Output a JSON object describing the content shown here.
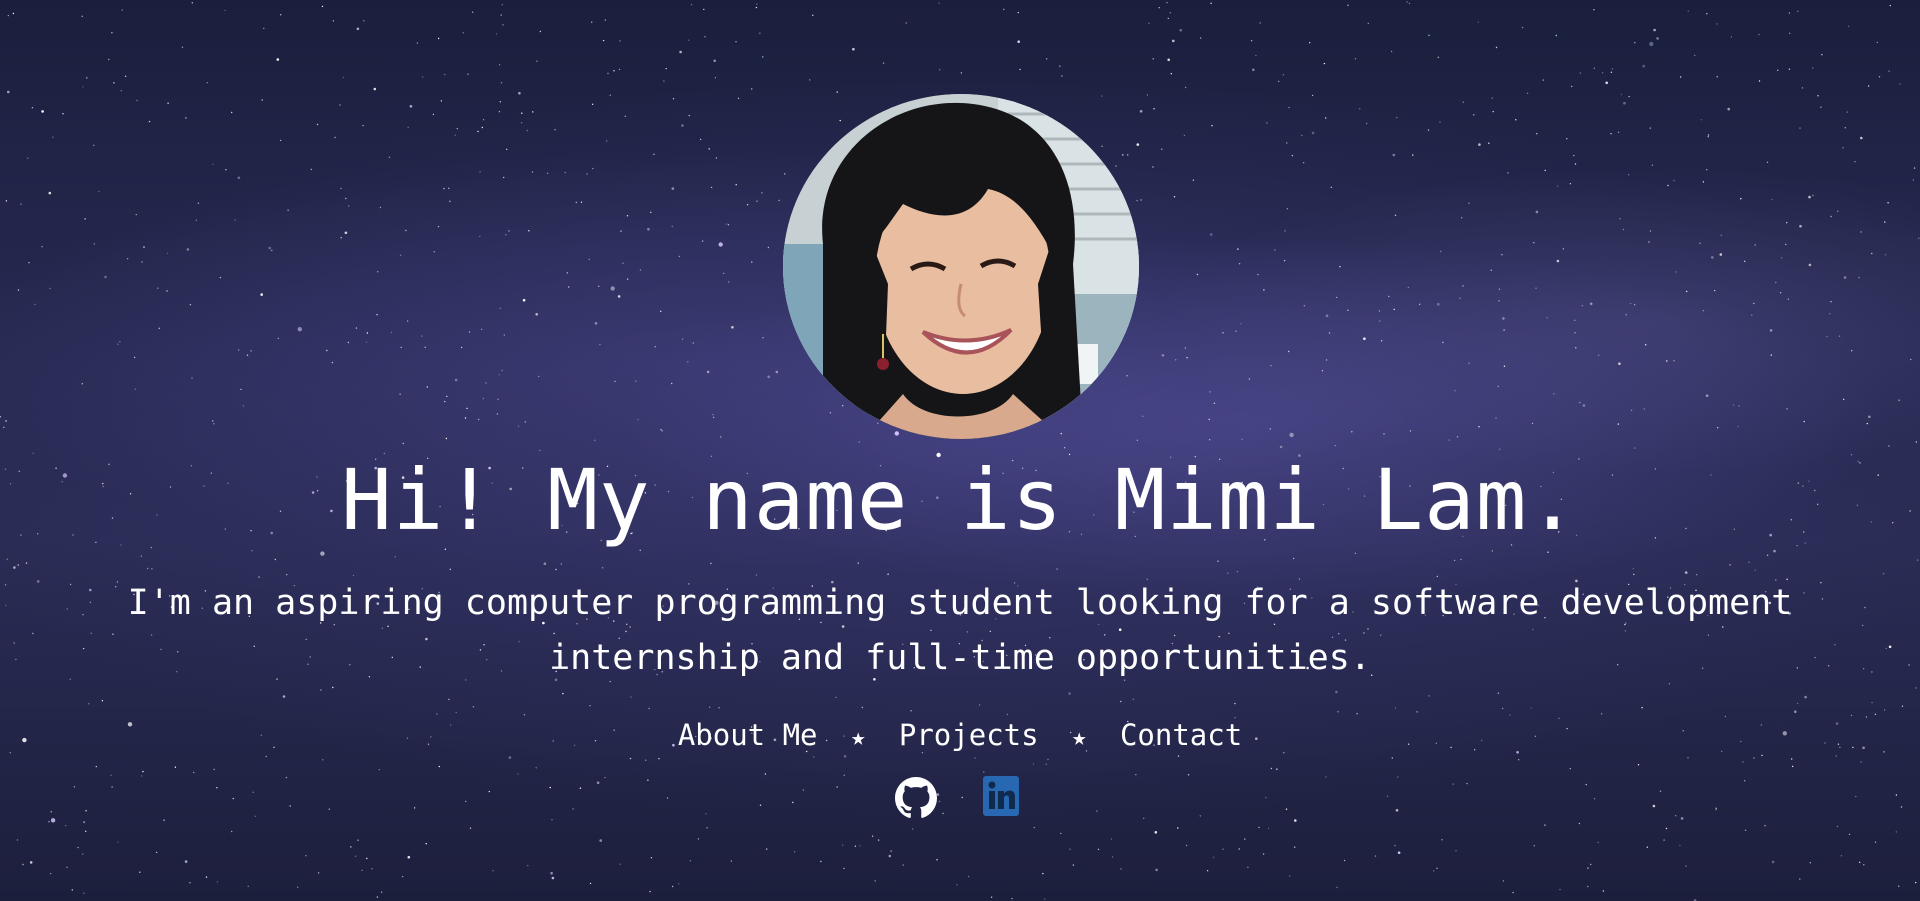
{
  "profile": {
    "photo_alt": "Mimi Lam"
  },
  "hero": {
    "headline": "Hi! My name is Mimi Lam.",
    "tagline_line1": "I'm an aspiring computer programming student looking for a software development",
    "tagline_line2": "internship and full-time opportunities."
  },
  "nav": {
    "items": [
      {
        "label": "About Me"
      },
      {
        "label": "Projects"
      },
      {
        "label": "Contact"
      }
    ],
    "separator": "★"
  },
  "social": {
    "links": [
      {
        "icon": "github-icon",
        "color": "#ffffff"
      },
      {
        "icon": "linkedin-icon",
        "color": "#2867b2"
      }
    ]
  },
  "theme": {
    "text_color": "#ffffff",
    "background": "starry-night-sky"
  }
}
